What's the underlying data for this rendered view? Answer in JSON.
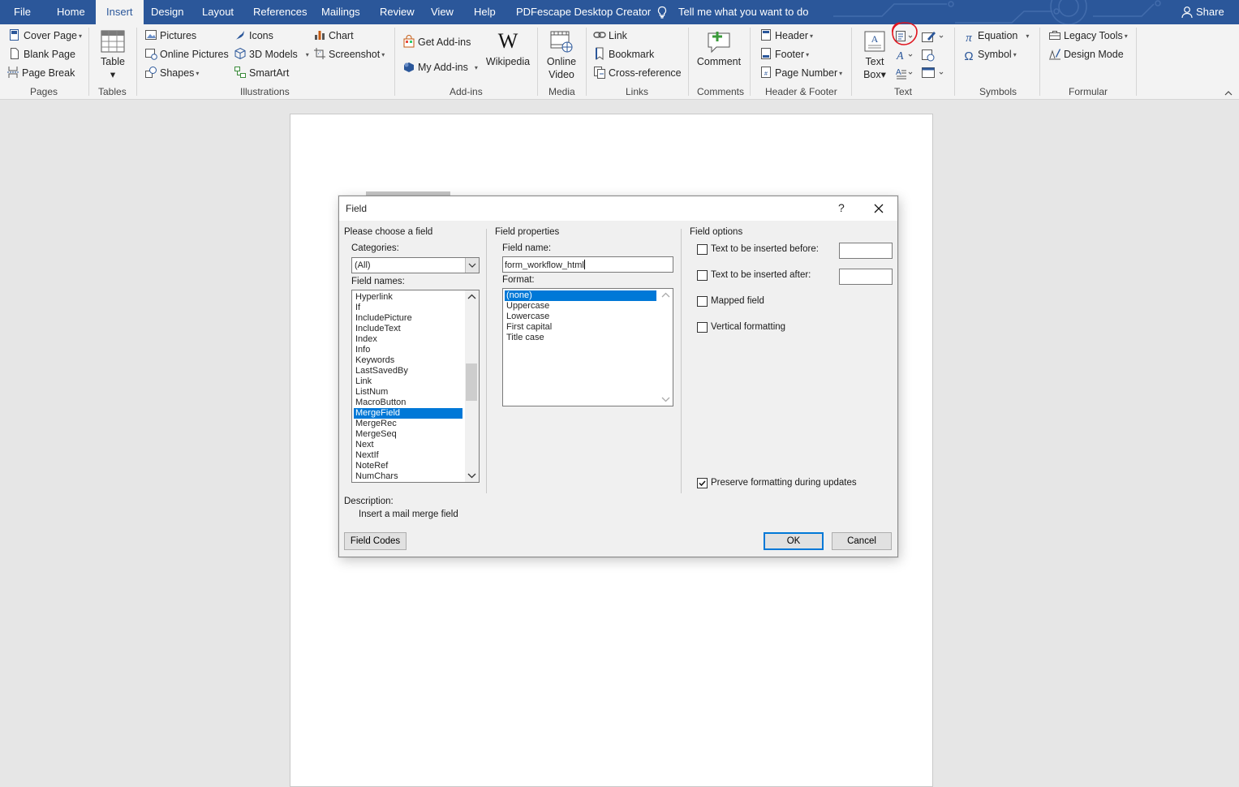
{
  "tabs": [
    {
      "label": "File"
    },
    {
      "label": "Home"
    },
    {
      "label": "Insert"
    },
    {
      "label": "Design"
    },
    {
      "label": "Layout"
    },
    {
      "label": "References"
    },
    {
      "label": "Mailings"
    },
    {
      "label": "Review"
    },
    {
      "label": "View"
    },
    {
      "label": "Help"
    },
    {
      "label": "PDFescape Desktop Creator"
    }
  ],
  "tell_me": "Tell me what you want to do",
  "share": "Share",
  "ribbon": {
    "pages": {
      "cover_page": "Cover Page",
      "blank_page": "Blank Page",
      "page_break": "Page Break",
      "label": "Pages"
    },
    "tables": {
      "table": "Table",
      "label": "Tables"
    },
    "illustrations": {
      "pictures": "Pictures",
      "online_pictures": "Online Pictures",
      "shapes": "Shapes",
      "icons": "Icons",
      "models_3d": "3D Models",
      "smartart": "SmartArt",
      "chart": "Chart",
      "screenshot": "Screenshot",
      "label": "Illustrations"
    },
    "addins": {
      "get_addins": "Get Add-ins",
      "my_addins": "My Add-ins",
      "wikipedia": "Wikipedia",
      "label": "Add-ins"
    },
    "media": {
      "online_video_1": "Online",
      "online_video_2": "Video",
      "label": "Media"
    },
    "links": {
      "link": "Link",
      "bookmark": "Bookmark",
      "cross_reference": "Cross-reference",
      "label": "Links"
    },
    "comments": {
      "comment": "Comment",
      "label": "Comments"
    },
    "header_footer": {
      "header": "Header",
      "footer": "Footer",
      "page_number": "Page Number",
      "label": "Header & Footer"
    },
    "text": {
      "text_box_1": "Text",
      "text_box_2": "Box",
      "label": "Text"
    },
    "symbols": {
      "equation": "Equation",
      "symbol": "Symbol",
      "label": "Symbols"
    },
    "formular": {
      "legacy_tools": "Legacy Tools",
      "design_mode": "Design Mode",
      "label": "Formular"
    }
  },
  "dialog": {
    "title": "Field",
    "help": "?",
    "choose_heading": "Please choose a field",
    "categories_label": "Categories:",
    "categories_value": "(All)",
    "field_names_label": "Field names:",
    "field_names": [
      "Hyperlink",
      "If",
      "IncludePicture",
      "IncludeText",
      "Index",
      "Info",
      "Keywords",
      "LastSavedBy",
      "Link",
      "ListNum",
      "MacroButton",
      "MergeField",
      "MergeRec",
      "MergeSeq",
      "Next",
      "NextIf",
      "NoteRef",
      "NumChars"
    ],
    "selected_field": "MergeField",
    "properties_heading": "Field properties",
    "field_name_label": "Field name:",
    "field_name_value": "form_workflow_html",
    "format_label": "Format:",
    "formats": [
      "(none)",
      "Uppercase",
      "Lowercase",
      "First capital",
      "Title case"
    ],
    "selected_format": "(none)",
    "options_heading": "Field options",
    "opt_before": "Text to be inserted before:",
    "opt_after": "Text to be inserted after:",
    "opt_mapped": "Mapped field",
    "opt_vertical": "Vertical formatting",
    "preserve": "Preserve formatting during updates",
    "preserve_checked": true,
    "description_label": "Description:",
    "description_text": "Insert a mail merge field",
    "field_codes_btn": "Field Codes",
    "ok_btn": "OK",
    "cancel_btn": "Cancel"
  },
  "colors": {
    "accent": "#2b579a",
    "selection": "#0078d7",
    "annotation": "#e0141e"
  }
}
